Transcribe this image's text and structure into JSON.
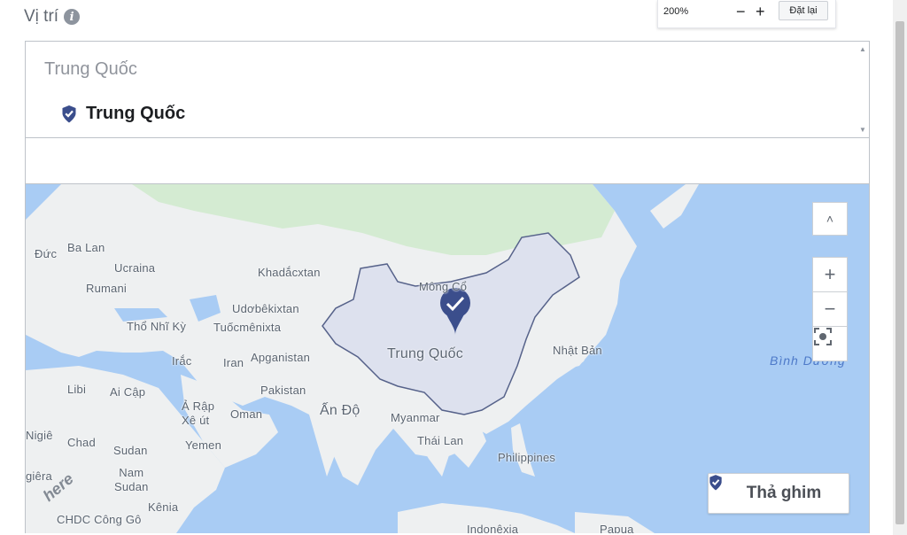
{
  "header": {
    "title": "Vị trí",
    "info_icon": "info-icon"
  },
  "zoom": {
    "level": "200%",
    "minus": "−",
    "plus": "+",
    "reset_label": "Đặt lại"
  },
  "location": {
    "country_group": "Trung Quốc",
    "selected_label": "Trung Quốc",
    "selected_icon": "pin-check-icon"
  },
  "search": {
    "placeholder": ""
  },
  "map": {
    "labels": {
      "ba_lan": "Ba Lan",
      "duc": "Đức",
      "ucraina": "Ucraina",
      "rumani": "Rumani",
      "tho_nhi_ky": "Thổ Nhĩ Kỳ",
      "khadacxtan": "Khadắcxtan",
      "udobekixtan": "Udơbêkixtan",
      "tuocmenixta": "Tuốcmênixta",
      "mong_co": "Mông Cổ",
      "trung_quoc": "Trung Quốc",
      "nhat_ban": "Nhật Bản",
      "irac": "Irắc",
      "iran": "Iran",
      "aganistan": "Apganistan",
      "pakistan": "Pakistan",
      "libi": "Libi",
      "ai_cap": "Ai Cập",
      "a_rap_xe_ut": "Ả Rập\nXê út",
      "oman": "Oman",
      "an_do": "Ấn Độ",
      "myanmar": "Myanmar",
      "thai_lan": "Thái Lan",
      "philippines": "Philippines",
      "nigie": "Nigiê",
      "chad": "Chad",
      "sudan": "Sudan",
      "yemen": "Yemen",
      "nam_sudan": "Nam\nSudan",
      "giera": "giêra",
      "kenia": "Kênia",
      "chdc_congo": "CHDC Công Gô",
      "indonesia": "Indonêxia",
      "papua": "Papua",
      "bac_binh_duong": "Bắc\nBình Dương",
      "here": "here"
    },
    "scroll_up": "˄",
    "zoom_in": "+",
    "zoom_out": "−",
    "fullscreen_icon": "focus-icon",
    "drop_pin_label": "Thả ghim",
    "drop_pin_icon": "pin-check-icon",
    "highlight_color": "#dde1ee",
    "pin_color": "#3b4e8c"
  }
}
